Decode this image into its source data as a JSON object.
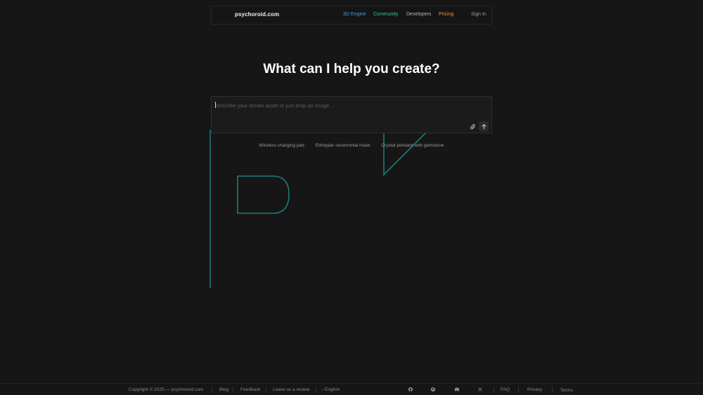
{
  "colors": {
    "background": "#161616",
    "nav_3d_engine": "#4a9be8",
    "nav_community": "#3cc98a",
    "nav_developers": "#b8b8b8",
    "nav_pricing": "#e8963c",
    "nav_sign_in": "#9a9a9a",
    "logo_stroke": "#1f7a78"
  },
  "header": {
    "brand": "psychoroid.com",
    "nav": {
      "engine": "3D Engine",
      "community": "Community",
      "developers": "Developers",
      "pricing": "Pricing",
      "sign_in": "Sign In"
    }
  },
  "main": {
    "headline": "What can I help you create?",
    "prompt": {
      "placeholder": "Describe your dream asset or just drop an image...",
      "value": "",
      "attach_icon": "paperclip-icon",
      "send_icon": "arrow-up-icon"
    },
    "suggestions": [
      "Wireless charging pad",
      "Ethiopian ceremonial mask",
      "Crystal pendant with gemstone"
    ]
  },
  "footer": {
    "copyright": "Copyright © 2025 — psychoroid.com",
    "blog": "Blog",
    "feedback": "Feedback",
    "review": "Leave us a review",
    "language": "English",
    "language_icon": "chevron-right-icon",
    "social_icons": [
      "github-icon",
      "product-hunt-icon",
      "discord-icon",
      "x-icon"
    ],
    "faq": "FAQ",
    "privacy": "Privacy",
    "terms": "Terms"
  }
}
